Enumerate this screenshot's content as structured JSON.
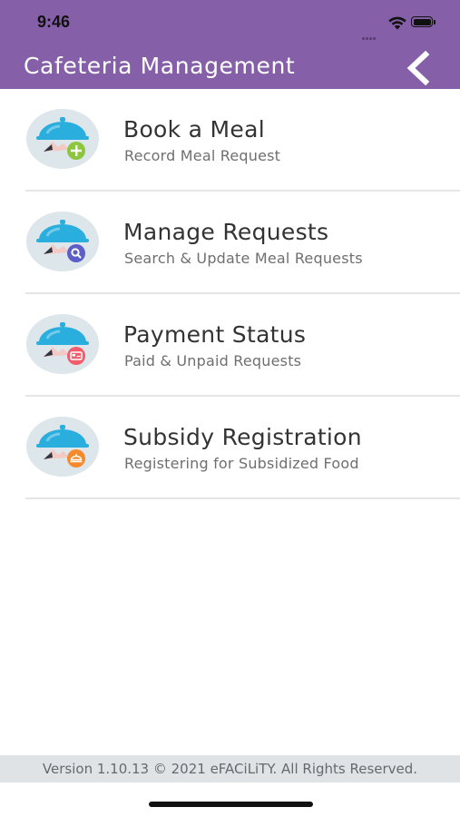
{
  "status_bar": {
    "time": "9:46"
  },
  "header": {
    "title": "Cafeteria Management",
    "back_icon": "chevron-left-icon",
    "background_color": "#8560a8"
  },
  "menu": [
    {
      "title": "Book a Meal",
      "subtitle": "Record Meal Request",
      "icon": "cloche-add-icon",
      "badge_color": "#8cc63f"
    },
    {
      "title": "Manage Requests",
      "subtitle": "Search & Update Meal Requests",
      "icon": "cloche-search-icon",
      "badge_color": "#5b5fc7"
    },
    {
      "title": "Payment Status",
      "subtitle": "Paid & Unpaid Requests",
      "icon": "cloche-payment-icon",
      "badge_color": "#f25c6b"
    },
    {
      "title": "Subsidy Registration",
      "subtitle": "Registering for Subsidized Food",
      "icon": "cloche-subsidy-icon",
      "badge_color": "#f58a2c"
    }
  ],
  "footer": {
    "text": "Version 1.10.13 © 2021 eFACiLiTY. All Rights Reserved."
  }
}
